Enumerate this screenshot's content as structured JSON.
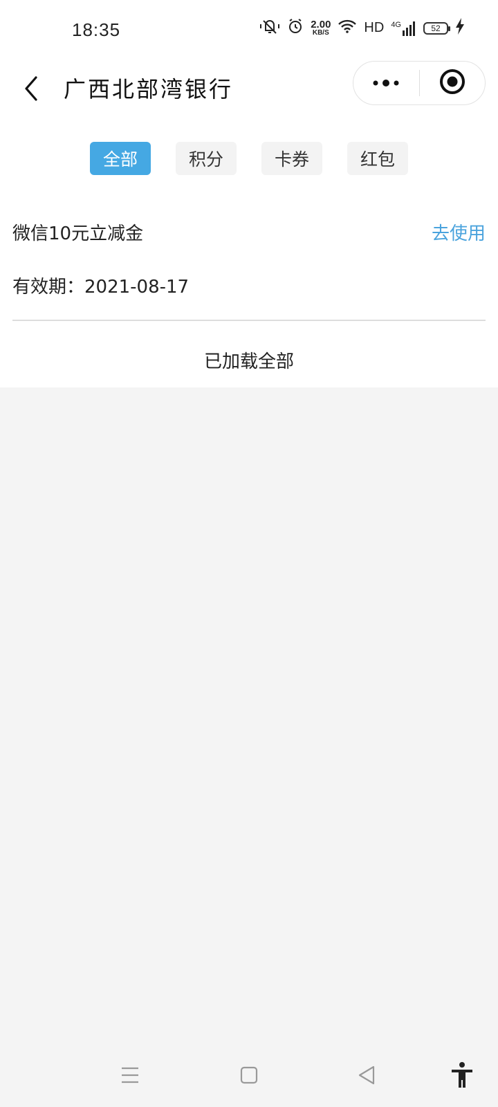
{
  "status_bar": {
    "time": "18:35",
    "net_speed_value": "2.00",
    "net_speed_unit": "KB/S",
    "hd_label": "HD",
    "network_label": "4G",
    "battery_level": "52",
    "icons": [
      "vibrate-off-icon",
      "alarm-icon",
      "wifi-icon",
      "signal-icon",
      "battery-icon",
      "charging-icon"
    ]
  },
  "nav": {
    "title": "广西北部湾银行",
    "back_icon": "chevron-left-icon",
    "more_icon": "more-dots-icon",
    "close_icon": "target-close-icon"
  },
  "tabs": [
    {
      "label": "全部",
      "active": true
    },
    {
      "label": "积分",
      "active": false
    },
    {
      "label": "卡券",
      "active": false
    },
    {
      "label": "红包",
      "active": false
    }
  ],
  "items": [
    {
      "name": "微信10元立减金",
      "action": "去使用",
      "validity": "有效期：2021-08-17"
    }
  ],
  "load_status": "已加载全部",
  "colors": {
    "accent": "#45a8e3",
    "link": "#4aa3dd",
    "background": "#f4f4f4"
  },
  "bottom_nav": {
    "icons": [
      "menu-icon",
      "home-square-icon",
      "back-triangle-icon",
      "accessibility-icon"
    ]
  }
}
